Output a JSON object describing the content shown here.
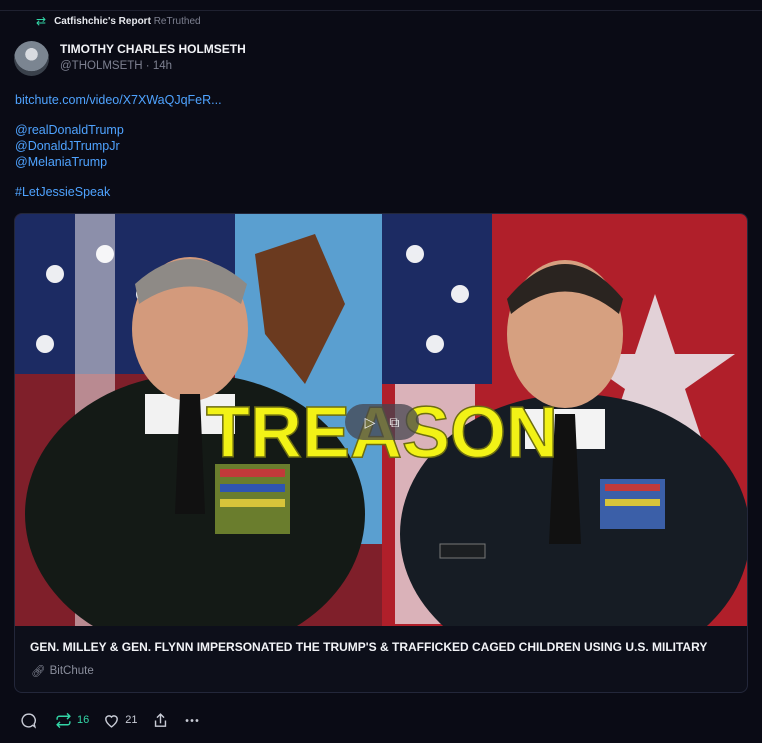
{
  "retruth_bar": {
    "icon": "retruth-icon",
    "user": "Catfishchic's Report",
    "action": "ReTruthed"
  },
  "post": {
    "author_name": "TIMOTHY CHARLES HOLMSETH",
    "handle_time": "@THOLMSETH · 14h",
    "link": "bitchute.com/video/X7XWaQJqFeR...",
    "mentions": [
      "@realDonaldTrump",
      "@DonaldJTrumpJr",
      "@MelaniaTrump"
    ],
    "hashtag": "#LetJessieSpeak"
  },
  "card": {
    "overlay_text": "TREASON",
    "title": "GEN. MILLEY & GEN. FLYNN IMPERSONATED THE TRUMP'S & TRAFFICKED CAGED CHILDREN USING U.S. MILITARY",
    "source": "BitChute",
    "play_icon": "play-icon",
    "external_icon": "external-link-icon",
    "link_icon": "link-icon"
  },
  "actions": {
    "reply_icon": "reply-icon",
    "retruth_count": "16",
    "like_count": "21",
    "share_icon": "share-icon",
    "more_icon": "more-icon"
  },
  "colors": {
    "background": "#0a0b15",
    "accent_green": "#33d6a6",
    "link_blue": "#4fa3ff",
    "overlay_yellow": "#f2f216"
  }
}
